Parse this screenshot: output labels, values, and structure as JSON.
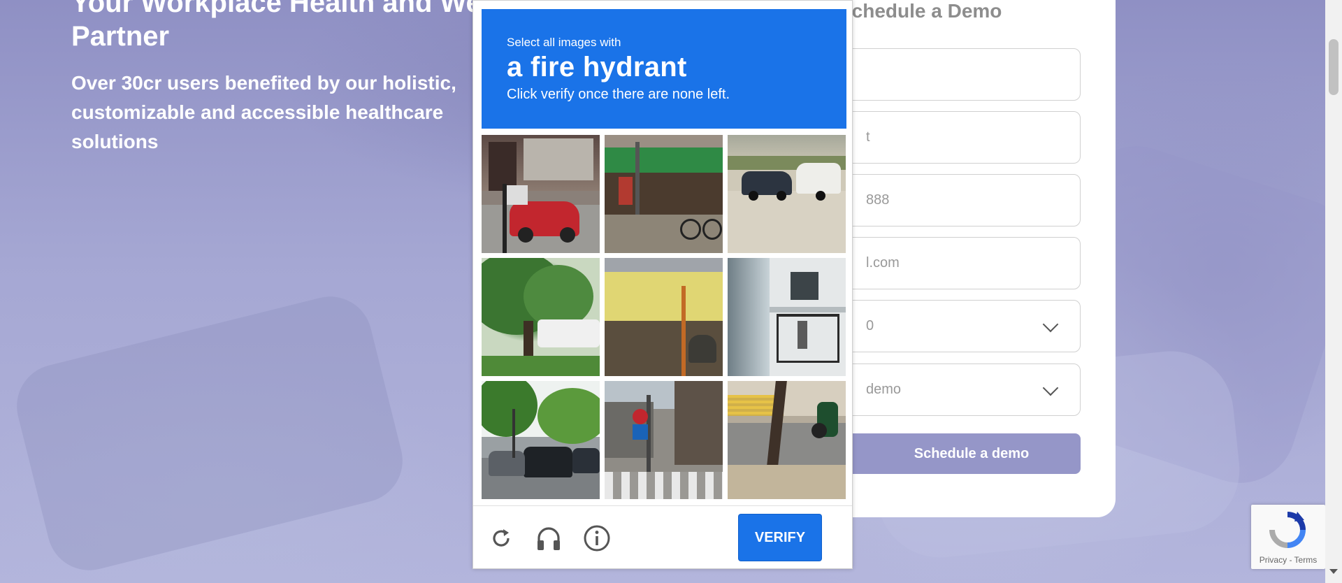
{
  "hero": {
    "title": "Your Workplace Health and Wellness Partner",
    "subtitle": "Over 30cr users benefited by our holistic, customizable and accessible healthcare solutions"
  },
  "form": {
    "title": "Schedule a Demo",
    "fields": [
      {
        "value": ""
      },
      {
        "value": "t"
      },
      {
        "value": "888"
      },
      {
        "value": "l.com"
      },
      {
        "value": "0"
      },
      {
        "value": "demo"
      }
    ],
    "submit_label": "Schedule a demo"
  },
  "captcha": {
    "instruction_small": "Select all images with",
    "target": "a fire hydrant",
    "hint": "Click verify once there are none left.",
    "verify_label": "VERIFY",
    "header_color": "#1a73e8",
    "tiles": [
      {
        "scene": "street-storefront-red-car"
      },
      {
        "scene": "market-stall-bicycle"
      },
      {
        "scene": "road-car-caravan"
      },
      {
        "scene": "tree-bus-roadside"
      },
      {
        "scene": "banner-sign-street-dirt"
      },
      {
        "scene": "apartment-balcony"
      },
      {
        "scene": "traffic-cars-trees"
      },
      {
        "scene": "street-sign-pole-crosswalk"
      },
      {
        "scene": "tree-motorcycle-road"
      }
    ],
    "icons": [
      "reload-icon",
      "audio-icon",
      "info-icon"
    ]
  },
  "badge": {
    "terms": "Privacy - Terms"
  }
}
